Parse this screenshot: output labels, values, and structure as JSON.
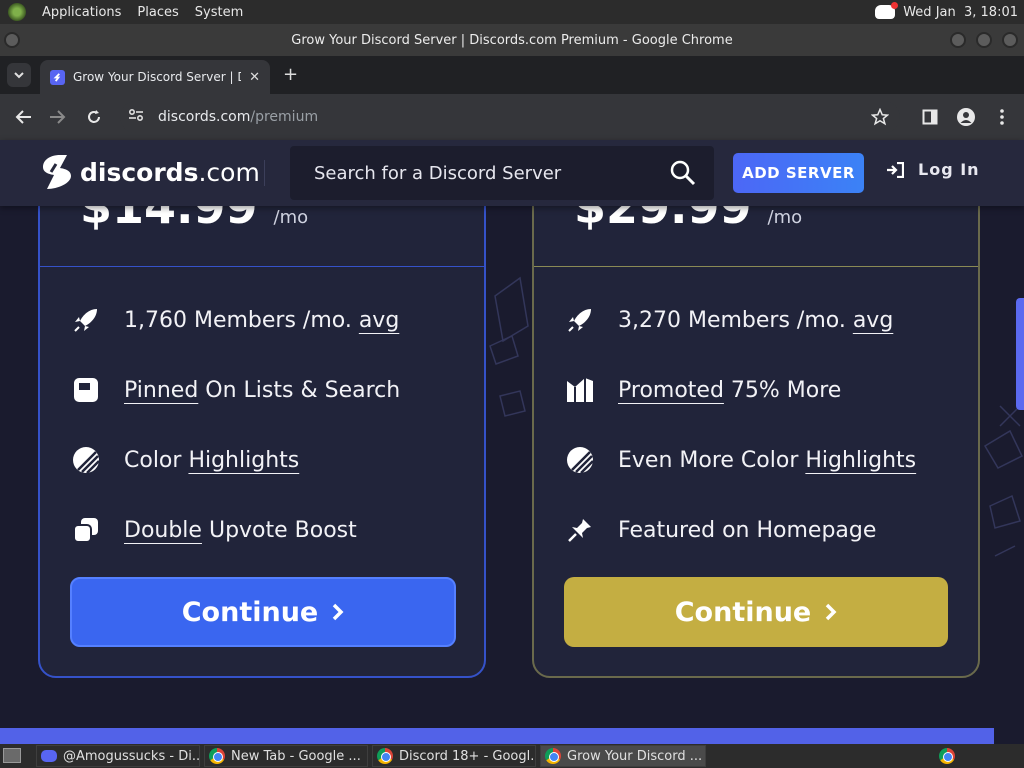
{
  "os_panel": {
    "menu": [
      "Applications",
      "Places",
      "System"
    ],
    "clock": "Wed Jan  3, 18:01"
  },
  "window": {
    "title": "Grow Your Discord Server | Discords.com Premium - Google Chrome"
  },
  "browser": {
    "active_tab_title": "Grow Your Discord Server | Di",
    "url_host": "discords.com",
    "url_path": "/premium"
  },
  "site": {
    "brand_bold": "discords",
    "brand_light": ".com",
    "search_placeholder": "Search for a Discord Server",
    "add_server": "ADD SERVER",
    "login": "Log In"
  },
  "cards": [
    {
      "price_suffix": "/mo",
      "features": [
        {
          "icon": "rocket-icon",
          "parts": [
            {
              "t": "1,760 Members /mo. ",
              "u": false
            },
            {
              "t": "avg",
              "u": true
            }
          ]
        },
        {
          "icon": "pin-square-icon",
          "parts": [
            {
              "t": "Pinned",
              "u": true
            },
            {
              "t": " On Lists & Search",
              "u": false
            }
          ]
        },
        {
          "icon": "color-palette-icon",
          "parts": [
            {
              "t": "Color ",
              "u": false
            },
            {
              "t": "Highlights",
              "u": true
            }
          ]
        },
        {
          "icon": "double-boost-icon",
          "parts": [
            {
              "t": "Double",
              "u": true
            },
            {
              "t": " Upvote Boost",
              "u": false
            }
          ]
        }
      ],
      "continue": "Continue",
      "accent": "#3a66f0"
    },
    {
      "price_suffix": "/mo",
      "features": [
        {
          "icon": "rocket-icon",
          "parts": [
            {
              "t": "3,270 Members /mo. ",
              "u": false
            },
            {
              "t": "avg",
              "u": true
            }
          ]
        },
        {
          "icon": "megaphone-icon",
          "parts": [
            {
              "t": "Promoted",
              "u": true
            },
            {
              "t": " 75% More",
              "u": false
            }
          ]
        },
        {
          "icon": "color-palette-icon",
          "parts": [
            {
              "t": "Even More Color ",
              "u": false
            },
            {
              "t": "Highlights",
              "u": true
            }
          ]
        },
        {
          "icon": "thumbtack-icon",
          "parts": [
            {
              "t": "Featured on Homepage",
              "u": false
            }
          ]
        }
      ],
      "continue": "Continue",
      "accent": "#c4ae42"
    }
  ],
  "taskbar": {
    "tasks": [
      {
        "icon": "discord-icon",
        "label": "@Amogussucks - Di..."
      },
      {
        "icon": "chrome-icon",
        "label": "New Tab - Google ..."
      },
      {
        "icon": "chrome-icon",
        "label": "Discord 18+ - Googl..."
      },
      {
        "icon": "chrome-icon",
        "label": "Grow Your Discord ..."
      }
    ]
  }
}
